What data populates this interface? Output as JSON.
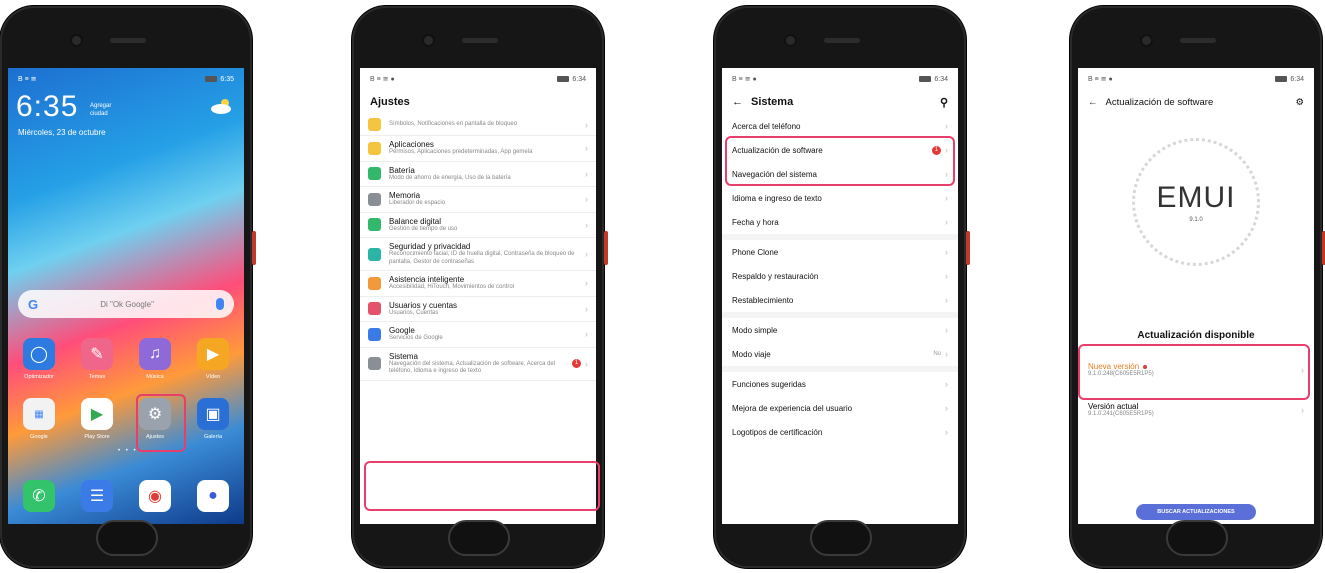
{
  "phone1": {
    "status_left": "B ≡ ≅",
    "status_right": "6:35",
    "time": "6:35",
    "city_line1": "Agregar",
    "city_line2": "ciudad",
    "date": "Miércoles, 23 de octubre",
    "google_hint": "Di \"Ok Google\"",
    "google_logo": "G",
    "apps_row1": [
      {
        "label": "Optimizador",
        "icon": "shield-icon",
        "color": "#2d7be0"
      },
      {
        "label": "Temas",
        "icon": "brush-icon",
        "color": "#f0668a"
      },
      {
        "label": "Música",
        "icon": "music-icon",
        "color": "#8e6ad8"
      },
      {
        "label": "Vídeo",
        "icon": "play-icon",
        "color": "#f5a623"
      }
    ],
    "apps_row2": [
      {
        "label": "Google",
        "icon": "folder-icon",
        "color": "#f2f2f2"
      },
      {
        "label": "Play Store",
        "icon": "playstore-icon",
        "color": "#ffffff"
      },
      {
        "label": "Ajustes",
        "icon": "gear-icon",
        "color": "#9aa3ad"
      },
      {
        "label": "Galería",
        "icon": "gallery-icon",
        "color": "#2a6fd6"
      }
    ],
    "dock": [
      {
        "icon": "phone-icon",
        "color": "#33c36b"
      },
      {
        "icon": "message-icon",
        "color": "#3b7be8"
      },
      {
        "icon": "chrome-icon",
        "color": "#ffffff"
      },
      {
        "icon": "camera-icon",
        "color": "#ffffff"
      }
    ]
  },
  "phone2": {
    "status_left": "B ≡ ≅ ●",
    "status_right": "6:34",
    "title": "Ajustes",
    "items": [
      {
        "title": "",
        "sub": "Símbolos, Notificaciones en pantalla de bloqueo",
        "color": "#f5c542"
      },
      {
        "title": "Aplicaciones",
        "sub": "Permisos, Aplicaciones predeterminadas, App gemela",
        "color": "#f5c542"
      },
      {
        "title": "Batería",
        "sub": "Modo de ahorro de energía, Uso de la batería",
        "color": "#33b86b"
      },
      {
        "title": "Memoria",
        "sub": "Liberador de espacio",
        "color": "#8a8f96"
      },
      {
        "title": "Balance digital",
        "sub": "Gestión de tiempo de uso",
        "color": "#33b86b"
      },
      {
        "title": "Seguridad y privacidad",
        "sub": "Reconocimiento facial, ID de huella digital, Contraseña de bloqueo de pantalla, Gestor de contraseñas",
        "color": "#2bb5a6"
      },
      {
        "title": "Asistencia inteligente",
        "sub": "Accesibilidad, HiTouch, Movimientos de control",
        "color": "#f29a3a"
      },
      {
        "title": "Usuarios y cuentas",
        "sub": "Usuarios, Cuentas",
        "color": "#e5536b"
      },
      {
        "title": "Google",
        "sub": "Servicios de Google",
        "color": "#3b7be8"
      },
      {
        "title": "Sistema",
        "sub": "Navegación del sistema, Actualización de software, Acerca del teléfono, Idioma e ingreso de texto",
        "color": "#8a8f96",
        "badge": "1"
      }
    ]
  },
  "phone3": {
    "status_left": "B ≡ ≅ ●",
    "status_right": "6:34",
    "title": "Sistema",
    "items": [
      {
        "title": "Acerca del teléfono"
      },
      {
        "title": "Actualización de software",
        "badge": "1"
      },
      {
        "title": "Navegación del sistema"
      },
      {
        "title": "Idioma e ingreso de texto"
      },
      {
        "title": "Fecha y hora"
      },
      {
        "title": "Phone Clone"
      },
      {
        "title": "Respaldo y restauración"
      },
      {
        "title": "Restablecimiento"
      },
      {
        "title": "Modo simple"
      },
      {
        "title": "Modo viaje",
        "value": "No"
      },
      {
        "title": "Funciones sugeridas"
      },
      {
        "title": "Mejora de experiencia del usuario"
      },
      {
        "title": "Logotipos de certificación"
      }
    ]
  },
  "phone4": {
    "status_left": "B ≡ ≅ ●",
    "status_right": "6:34",
    "title": "Actualización de software",
    "logo": "EMUI",
    "logo_version": "9.1.0",
    "available": "Actualización disponible",
    "new_version_label": "Nueva versión",
    "new_version_value": "9.1.0.248(C605E5R1P5)",
    "current_version_label": "Versión actual",
    "current_version_value": "9.1.0.241(C605E5R1P5)",
    "check_button": "BUSCAR ACTUALIZACIONES"
  },
  "colors": {
    "highlight": "#e83e6c",
    "badge": "#e53935",
    "button": "#5b6fd9"
  }
}
